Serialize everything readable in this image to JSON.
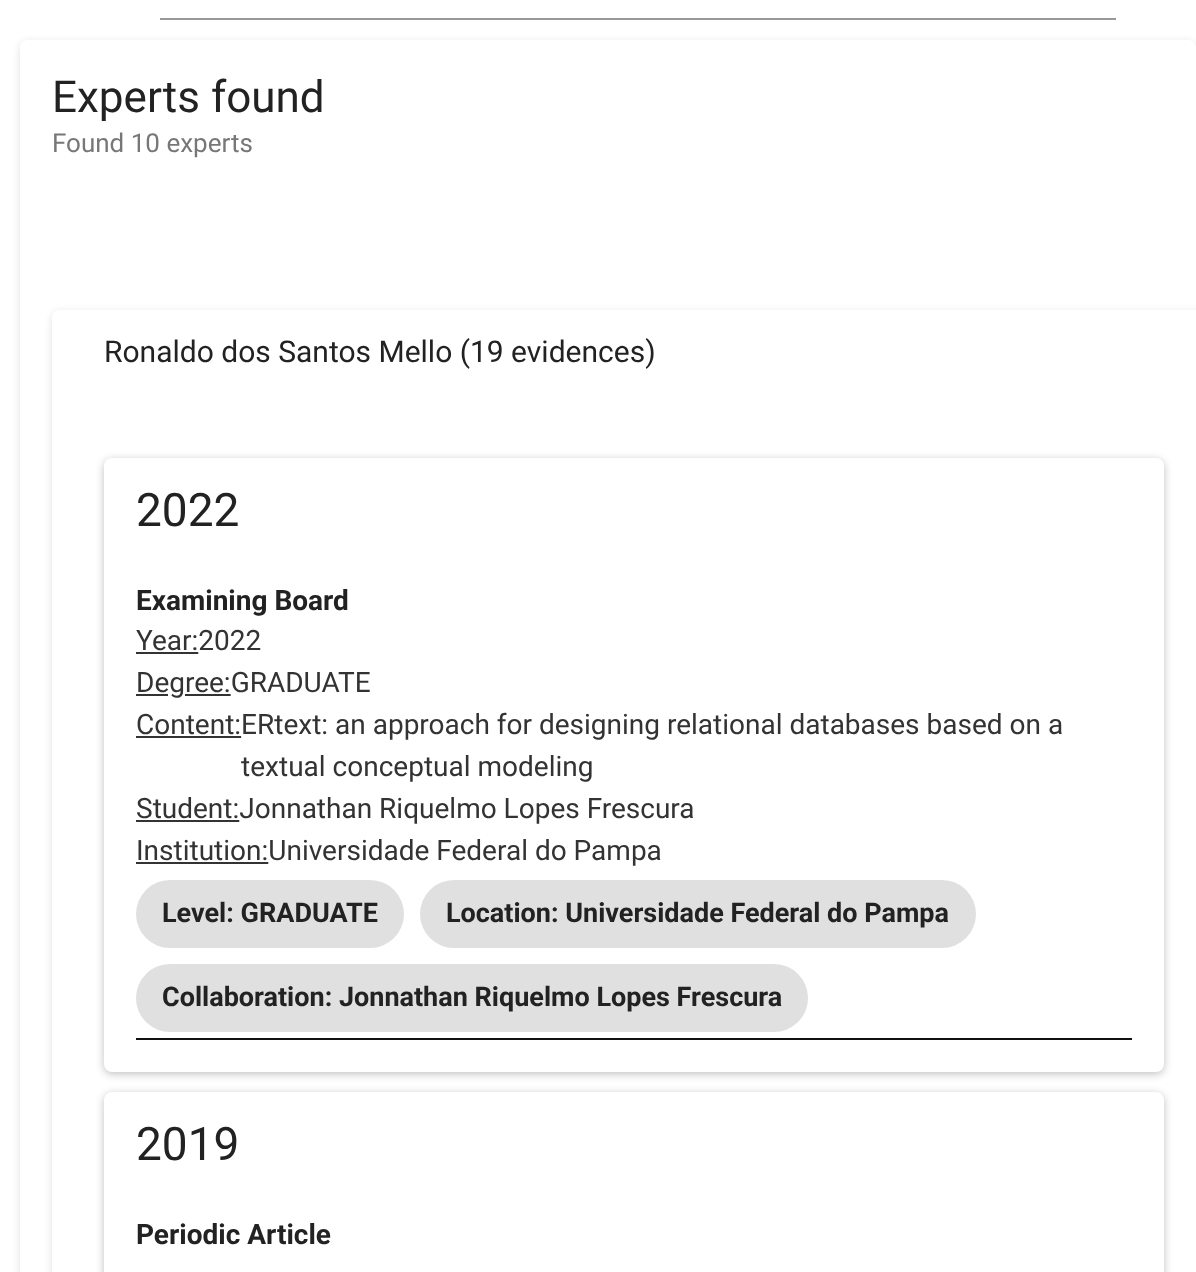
{
  "results": {
    "title": "Experts found",
    "subtitle": "Found 10 experts"
  },
  "experts": [
    {
      "name": "Ronaldo dos Santos Mello (19 evidences)",
      "evidences": [
        {
          "year": "2022",
          "type": "Examining Board",
          "fields": [
            {
              "label": "Year:",
              "value": "2022"
            },
            {
              "label": "Degree:",
              "value": "GRADUATE"
            },
            {
              "label": "Content:",
              "value": "ERtext: an approach for designing relational databases based on a textual conceptual modeling"
            },
            {
              "label": "Student:",
              "value": "Jonnathan Riquelmo Lopes Frescura"
            },
            {
              "label": "Institution:",
              "value": "Universidade Federal do Pampa"
            }
          ],
          "chips": [
            "Level: GRADUATE",
            "Location: Universidade Federal do Pampa",
            "Collaboration: Jonnathan Riquelmo Lopes Frescura"
          ]
        },
        {
          "year": "2019",
          "type": "Periodic Article"
        }
      ]
    }
  ]
}
